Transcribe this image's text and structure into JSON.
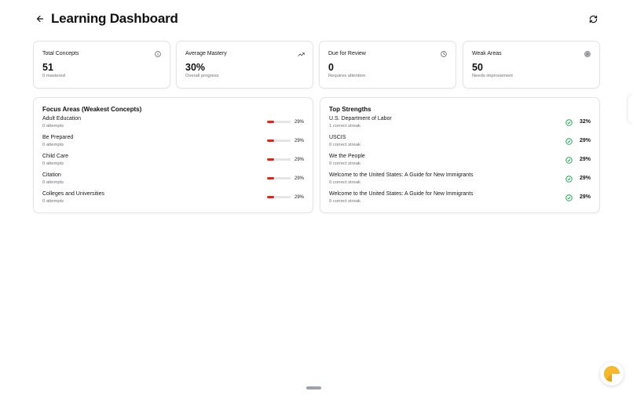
{
  "header": {
    "title": "Learning Dashboard",
    "back_icon": "arrow-left-icon",
    "refresh_icon": "refresh-icon"
  },
  "stats": [
    {
      "title": "Total Concepts",
      "value": "51",
      "subtitle": "0 mastered",
      "icon": "info-icon"
    },
    {
      "title": "Average Mastery",
      "value": "30%",
      "subtitle": "Overall progress",
      "icon": "trending-up-icon"
    },
    {
      "title": "Due for Review",
      "value": "0",
      "subtitle": "Requires attention",
      "icon": "clock-icon"
    },
    {
      "title": "Weak Areas",
      "value": "50",
      "subtitle": "Needs improvement",
      "icon": "target-icon"
    }
  ],
  "focus_areas": {
    "title": "Focus Areas (Weakest Concepts)",
    "items": [
      {
        "name": "Adult Education",
        "attempts": "0 attempts",
        "percent": "29%",
        "mastery": 0.29
      },
      {
        "name": "Be Prepared",
        "attempts": "0 attempts",
        "percent": "29%",
        "mastery": 0.29
      },
      {
        "name": "Child Care",
        "attempts": "0 attempts",
        "percent": "29%",
        "mastery": 0.29
      },
      {
        "name": "Citation",
        "attempts": "0 attempts",
        "percent": "29%",
        "mastery": 0.29
      },
      {
        "name": "Colleges and Universities",
        "attempts": "0 attempts",
        "percent": "29%",
        "mastery": 0.29
      }
    ]
  },
  "top_strengths": {
    "title": "Top Strengths",
    "items": [
      {
        "name": "U.S. Department of Labor",
        "streak": "1 correct streak",
        "percent": "32%"
      },
      {
        "name": "USCIS",
        "streak": "0 correct streak",
        "percent": "29%"
      },
      {
        "name": "We the People",
        "streak": "0 correct streak",
        "percent": "29%"
      },
      {
        "name": "Welcome to the United States: A Guide for New Immigrants",
        "streak": "0 correct streak",
        "percent": "29%"
      },
      {
        "name": "Welcome to the United States: A Guide for New Immigrants",
        "streak": "0 correct streak",
        "percent": "29%"
      }
    ]
  },
  "colors": {
    "weak_bar": "#dc2626",
    "strength_check": "#16a34a",
    "fab_accent": "#f5b82e"
  }
}
